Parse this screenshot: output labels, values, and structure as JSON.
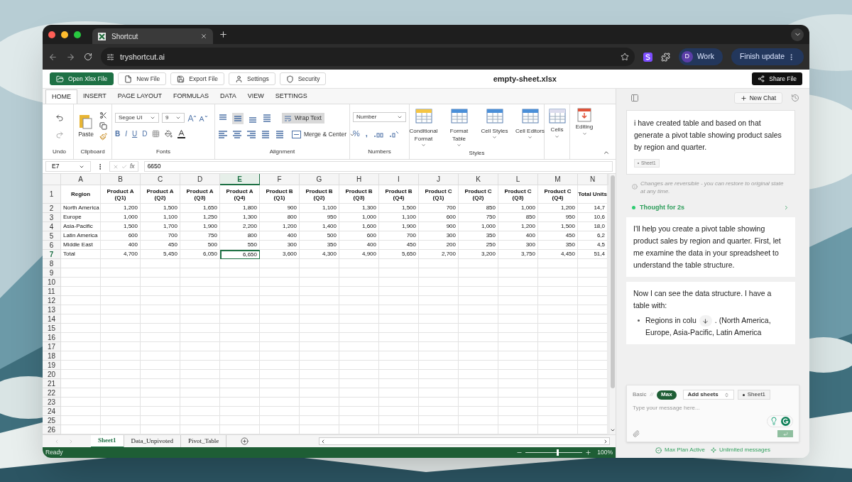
{
  "browser": {
    "tab_title": "Shortcut",
    "url": "tryshortcut.ai",
    "profile_initial": "D",
    "profile_name": "Work",
    "update_button": "Finish update"
  },
  "toolbar": {
    "buttons": [
      {
        "label": "Open Xlsx File",
        "kind": "open"
      },
      {
        "label": "New File",
        "kind": "new"
      },
      {
        "label": "Export File",
        "kind": "export"
      },
      {
        "label": "Settings",
        "kind": "settings"
      },
      {
        "label": "Security",
        "kind": "security"
      }
    ],
    "file_name": "empty-sheet.xlsx",
    "share_button": "Share File"
  },
  "ribbon": {
    "tabs": [
      {
        "label": "HOME",
        "selected": true
      },
      {
        "label": "INSERT",
        "selected": false
      },
      {
        "label": "PAGE LAYOUT",
        "selected": false
      },
      {
        "label": "FORMULAS",
        "selected": false
      },
      {
        "label": "DATA",
        "selected": false
      },
      {
        "label": "VIEW",
        "selected": false
      },
      {
        "label": "SETTINGS",
        "selected": false
      }
    ],
    "undo_label": "Undo",
    "paste": "Paste",
    "clipboard_label": "Clipboard",
    "font": "Segoe UI",
    "font_size": "9",
    "font_buttons": [
      "B",
      "I",
      "U",
      "D"
    ],
    "fonts_label": "Fonts",
    "wrap_text": {
      "label": "Wrap Text",
      "on": true
    },
    "merge": "Merge & Center",
    "alignment_label": "Alignment",
    "number_format": "Number",
    "percent": "%",
    "comma": ",",
    "numbers_label": "Numbers",
    "styles": [
      "Conditional Format",
      "Format Table",
      "Cell Styles",
      "Cell Editors"
    ],
    "styles_label": "Styles",
    "cells": "Cells",
    "editing": "Editing"
  },
  "formula_bar": {
    "name_box": "E7",
    "fx": "fx",
    "value": "6650"
  },
  "sheet": {
    "columns": [
      {
        "label": "A",
        "selected": false
      },
      {
        "label": "B",
        "selected": false
      },
      {
        "label": "C",
        "selected": false
      },
      {
        "label": "D",
        "selected": false
      },
      {
        "label": "E",
        "selected": true
      },
      {
        "label": "F",
        "selected": false
      },
      {
        "label": "G",
        "selected": false
      },
      {
        "label": "H",
        "selected": false
      },
      {
        "label": "I",
        "selected": false
      },
      {
        "label": "J",
        "selected": false
      },
      {
        "label": "K",
        "selected": false
      },
      {
        "label": "L",
        "selected": false
      },
      {
        "label": "M",
        "selected": false
      },
      {
        "label": "N",
        "selected": false
      }
    ],
    "rows": [
      {
        "number": "1",
        "selected": false,
        "cells": [
          "Region",
          "Product A (Q1)",
          "Product A (Q2)",
          "Product A (Q3)",
          "Product A (Q4)",
          "Product B (Q1)",
          "Product B (Q2)",
          "Product B (Q3)",
          "Product B (Q4)",
          "Product C (Q1)",
          "Product C (Q2)",
          "Product C (Q3)",
          "Product C (Q4)",
          "Total Units"
        ]
      },
      {
        "number": "2",
        "selected": false,
        "cells": [
          "North America",
          "1,200",
          "1,500",
          "1,650",
          "1,800",
          "900",
          "1,100",
          "1,300",
          "1,500",
          "700",
          "850",
          "1,000",
          "1,200",
          "14,7"
        ]
      },
      {
        "number": "3",
        "selected": false,
        "cells": [
          "Europe",
          "1,000",
          "1,100",
          "1,250",
          "1,300",
          "800",
          "950",
          "1,000",
          "1,100",
          "600",
          "750",
          "850",
          "950",
          "10,6"
        ]
      },
      {
        "number": "4",
        "selected": false,
        "cells": [
          "Asia-Pacific",
          "1,500",
          "1,700",
          "1,900",
          "2,200",
          "1,200",
          "1,400",
          "1,600",
          "1,900",
          "900",
          "1,000",
          "1,200",
          "1,500",
          "18,0"
        ]
      },
      {
        "number": "5",
        "selected": false,
        "cells": [
          "Latin America",
          "600",
          "700",
          "750",
          "800",
          "400",
          "500",
          "600",
          "700",
          "300",
          "350",
          "400",
          "450",
          "6,2"
        ]
      },
      {
        "number": "6",
        "selected": false,
        "cells": [
          "Middle East",
          "400",
          "450",
          "500",
          "550",
          "300",
          "350",
          "400",
          "450",
          "200",
          "250",
          "300",
          "350",
          "4,5"
        ]
      },
      {
        "number": "7",
        "selected": true,
        "cells": [
          "Total",
          "4,700",
          "5,450",
          "6,050",
          "6,650",
          "3,600",
          "4,300",
          "4,900",
          "5,650",
          "2,700",
          "3,200",
          "3,750",
          "4,450",
          "51,4"
        ]
      },
      {
        "number": "8",
        "selected": false
      },
      {
        "number": "9",
        "selected": false
      },
      {
        "number": "10",
        "selected": false
      },
      {
        "number": "11",
        "selected": false
      },
      {
        "number": "12",
        "selected": false
      },
      {
        "number": "13",
        "selected": false
      },
      {
        "number": "14",
        "selected": false
      },
      {
        "number": "15",
        "selected": false
      },
      {
        "number": "16",
        "selected": false
      },
      {
        "number": "17",
        "selected": false
      },
      {
        "number": "18",
        "selected": false
      },
      {
        "number": "19",
        "selected": false
      },
      {
        "number": "20",
        "selected": false
      },
      {
        "number": "21",
        "selected": false
      },
      {
        "number": "22",
        "selected": false
      },
      {
        "number": "23",
        "selected": false
      },
      {
        "number": "24",
        "selected": false
      },
      {
        "number": "25",
        "selected": false
      },
      {
        "number": "26",
        "selected": false
      }
    ],
    "tabs": [
      {
        "label": "Sheet1",
        "selected": true
      },
      {
        "label": "Data_Unpivoted",
        "selected": false
      },
      {
        "label": "Pivot_Table",
        "selected": false
      }
    ]
  },
  "status_bar": {
    "text": "Ready",
    "zoom": {
      "level": 0.55
    },
    "zoom_reading": "100%"
  },
  "chat": {
    "new_chat": "New Chat",
    "messages": [
      {
        "kind": "user",
        "text": "i have created table and based on that generate a pivot table showing product sales by region and quarter.",
        "chip": "Sheet1"
      },
      {
        "kind": "notice",
        "text": "Changes are reversible - you can restore to original state at any time."
      },
      {
        "kind": "thought",
        "text": "Thought for 2s"
      },
      {
        "kind": "assistant",
        "text": "I'll help you create a pivot table showing product sales by region and quarter. First, let me examine the data in your spreadsheet to understand the table structure."
      },
      {
        "kind": "assistant",
        "text": "Now I can see the data structure. I have a table with:",
        "bullets": [
          {
            "before": "Regions in colu",
            "after": ". (North America, Europe, Asia-Pacific, Latin America"
          }
        ]
      }
    ],
    "composer": {
      "modes": [
        {
          "label": "Basic",
          "selected": false
        },
        {
          "label": "Max",
          "selected": true
        }
      ],
      "separator": "//",
      "add_sheets": "Add sheets",
      "chip": "Sheet1",
      "placeholder": "Type your message here..."
    },
    "footer": {
      "plan": "Max Plan Active",
      "messages": "Unlimited messages"
    }
  }
}
